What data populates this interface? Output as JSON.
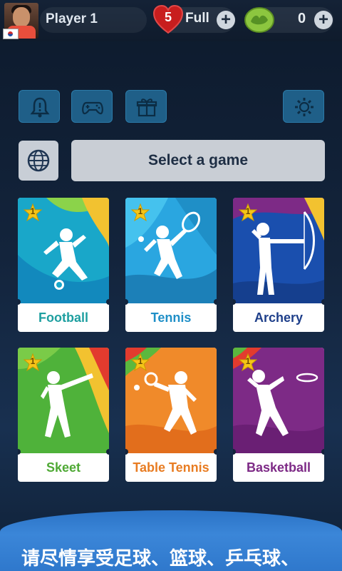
{
  "header": {
    "player_name": "Player 1",
    "lives_count": "5",
    "lives_status": "Full",
    "coins_count": "0"
  },
  "toolbar": {
    "select_game_label": "Select a game"
  },
  "games": [
    {
      "name": "Football",
      "level": "1",
      "color": "#1e9fa0"
    },
    {
      "name": "Tennis",
      "level": "1",
      "color": "#1f8fc7"
    },
    {
      "name": "Archery",
      "level": "1",
      "color": "#1e3f8a"
    },
    {
      "name": "Skeet",
      "level": "1",
      "color": "#4fa935"
    },
    {
      "name": "Table Tennis",
      "level": "1",
      "color": "#e87c22"
    },
    {
      "name": "Basketball",
      "level": "1",
      "color": "#7d2a86"
    }
  ],
  "banner": {
    "text": "请尽情享受足球、篮球、乒乓球、"
  },
  "colors": {
    "accent_blue": "#2b73c6",
    "icon_button": "#1f5f88",
    "heart_red": "#c81e1e",
    "star_yellow": "#f5c518"
  }
}
